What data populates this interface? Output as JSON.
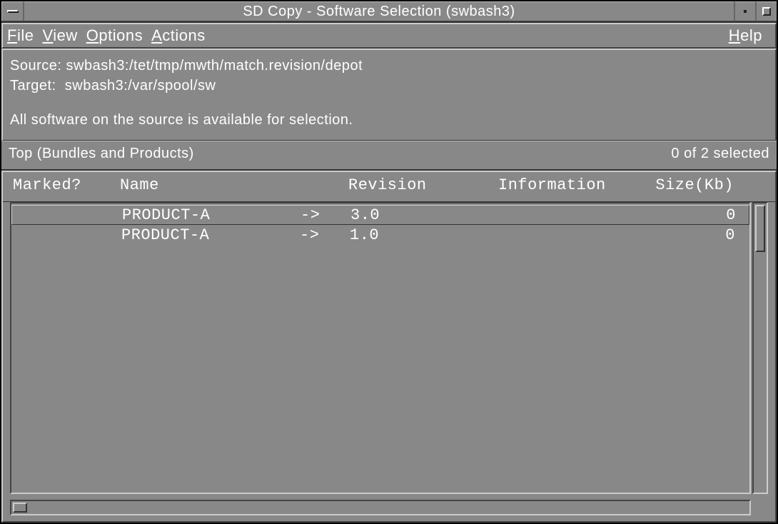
{
  "title": "SD Copy - Software Selection (swbash3)",
  "menu": {
    "file": "File",
    "view": "View",
    "options": "Options",
    "actions": "Actions",
    "help": "Help"
  },
  "info": {
    "source_label": "Source:",
    "source_value": "swbash3:/tet/tmp/mwth/match.revision/depot",
    "target_label": "Target:",
    "target_value": "swbash3:/var/spool/sw",
    "availability": "All software on the source is available for selection."
  },
  "status": {
    "path": "Top (Bundles and Products)",
    "selected": "0 of 2 selected"
  },
  "columns": {
    "marked": "Marked?",
    "name": "Name",
    "revision": "Revision",
    "information": "Information",
    "size": "Size(Kb)"
  },
  "rows": [
    {
      "marked": "",
      "name": "PRODUCT-A",
      "arrow": "->",
      "revision": "3.0",
      "information": "",
      "size": "0"
    },
    {
      "marked": "",
      "name": "PRODUCT-A",
      "arrow": "->",
      "revision": "1.0",
      "information": "",
      "size": "0"
    }
  ]
}
